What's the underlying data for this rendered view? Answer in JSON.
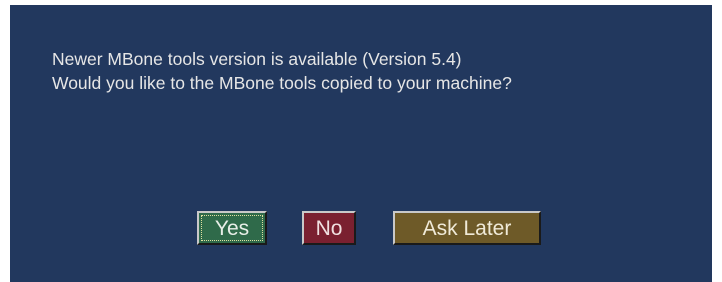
{
  "dialog": {
    "message_line1": "Newer MBone tools version is available (Version 5.4)",
    "message_line2": "Would you like to the MBone tools copied to your machine?",
    "buttons": {
      "yes_label": "Yes",
      "no_label": "No",
      "later_label": "Ask Later"
    },
    "colors": {
      "background": "#22385e",
      "yes": "#2f6a4a",
      "no": "#7a2030",
      "later": "#6e5a28"
    }
  }
}
